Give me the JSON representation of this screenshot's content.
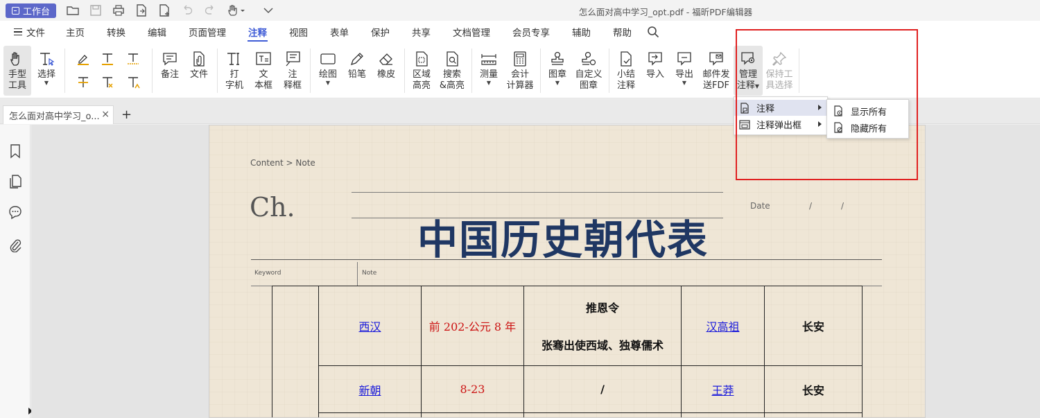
{
  "titlebar": {
    "workbench_label": "工作台",
    "window_title": "怎么面对高中学习_opt.pdf - 福昕PDF编辑器",
    "quick_access": [
      "open-folder-icon",
      "save-icon",
      "print-icon",
      "export-icon",
      "new-file-icon",
      "undo-icon",
      "redo-icon",
      "hand-dropdown-icon",
      "more-dropdown-icon"
    ]
  },
  "menu": {
    "file_label": "文件",
    "items": [
      "主页",
      "转换",
      "编辑",
      "页面管理",
      "注释",
      "视图",
      "表单",
      "保护",
      "共享",
      "文档管理",
      "会员专享",
      "辅助",
      "帮助"
    ],
    "active_index": 4
  },
  "ribbon": {
    "hand_tool": {
      "line1": "手型",
      "line2": "工具"
    },
    "select_tool": {
      "line1": "选择"
    },
    "note": "备注",
    "file": "文件",
    "typewriter": {
      "line1": "打",
      "line2": "字机"
    },
    "textbox": {
      "line1": "文",
      "line2": "本框"
    },
    "callout": {
      "line1": "注",
      "line2": "释框"
    },
    "drawing": "绘图",
    "pencil": "铅笔",
    "eraser": "橡皮",
    "area_highlight": {
      "line1": "区域",
      "line2": "高亮"
    },
    "search_highlight": {
      "line1": "搜索",
      "line2": "&高亮"
    },
    "measure": "测量",
    "calculator": {
      "line1": "会计",
      "line2": "计算器"
    },
    "stamp": "图章",
    "custom_stamp": {
      "line1": "自定义",
      "line2": "图章"
    },
    "summarize": {
      "line1": "小结",
      "line2": "注释"
    },
    "import": "导入",
    "export": "导出",
    "email_fdf": {
      "line1": "邮件发",
      "line2": "送FDF"
    },
    "manage_comments": {
      "line1": "管理",
      "line2": "注释"
    },
    "keep_tool": {
      "line1": "保持工",
      "line2": "具选择"
    }
  },
  "tabs": {
    "doc_tab_label": "怎么面对高中学习_o...",
    "close_symbol": "×",
    "add_symbol": "+"
  },
  "dropdown": {
    "items": [
      "注释",
      "注释弹出框"
    ],
    "submenu": [
      "显示所有",
      "隐藏所有"
    ]
  },
  "document": {
    "breadcrumb": "Content  >  Note",
    "ch": "Ch.",
    "date_label": "Date",
    "date_slashes": "//",
    "title": "中国历史朝代表",
    "keyword_label": "Keyword",
    "note_label": "Note",
    "rows": [
      {
        "dynasty": "西汉 ",
        "period": "前 202-公元 8 年",
        "event_line1": "推恩令",
        "event_line2": "张骞出使西域、独尊儒术",
        "founder": "汉高祖",
        "capital": "长安"
      },
      {
        "dynasty": "新朝",
        "period": "8-23",
        "event_line1": "/",
        "event_line2": "",
        "founder": "王莽",
        "capital": "长安"
      }
    ]
  },
  "colors": {
    "accent": "#3e5bd6",
    "workbench_bg": "#5c67c9",
    "title_color": "#1f3763",
    "link_color": "#1a1adb",
    "period_color": "#cc1111",
    "highlight_box": "#e02020"
  }
}
